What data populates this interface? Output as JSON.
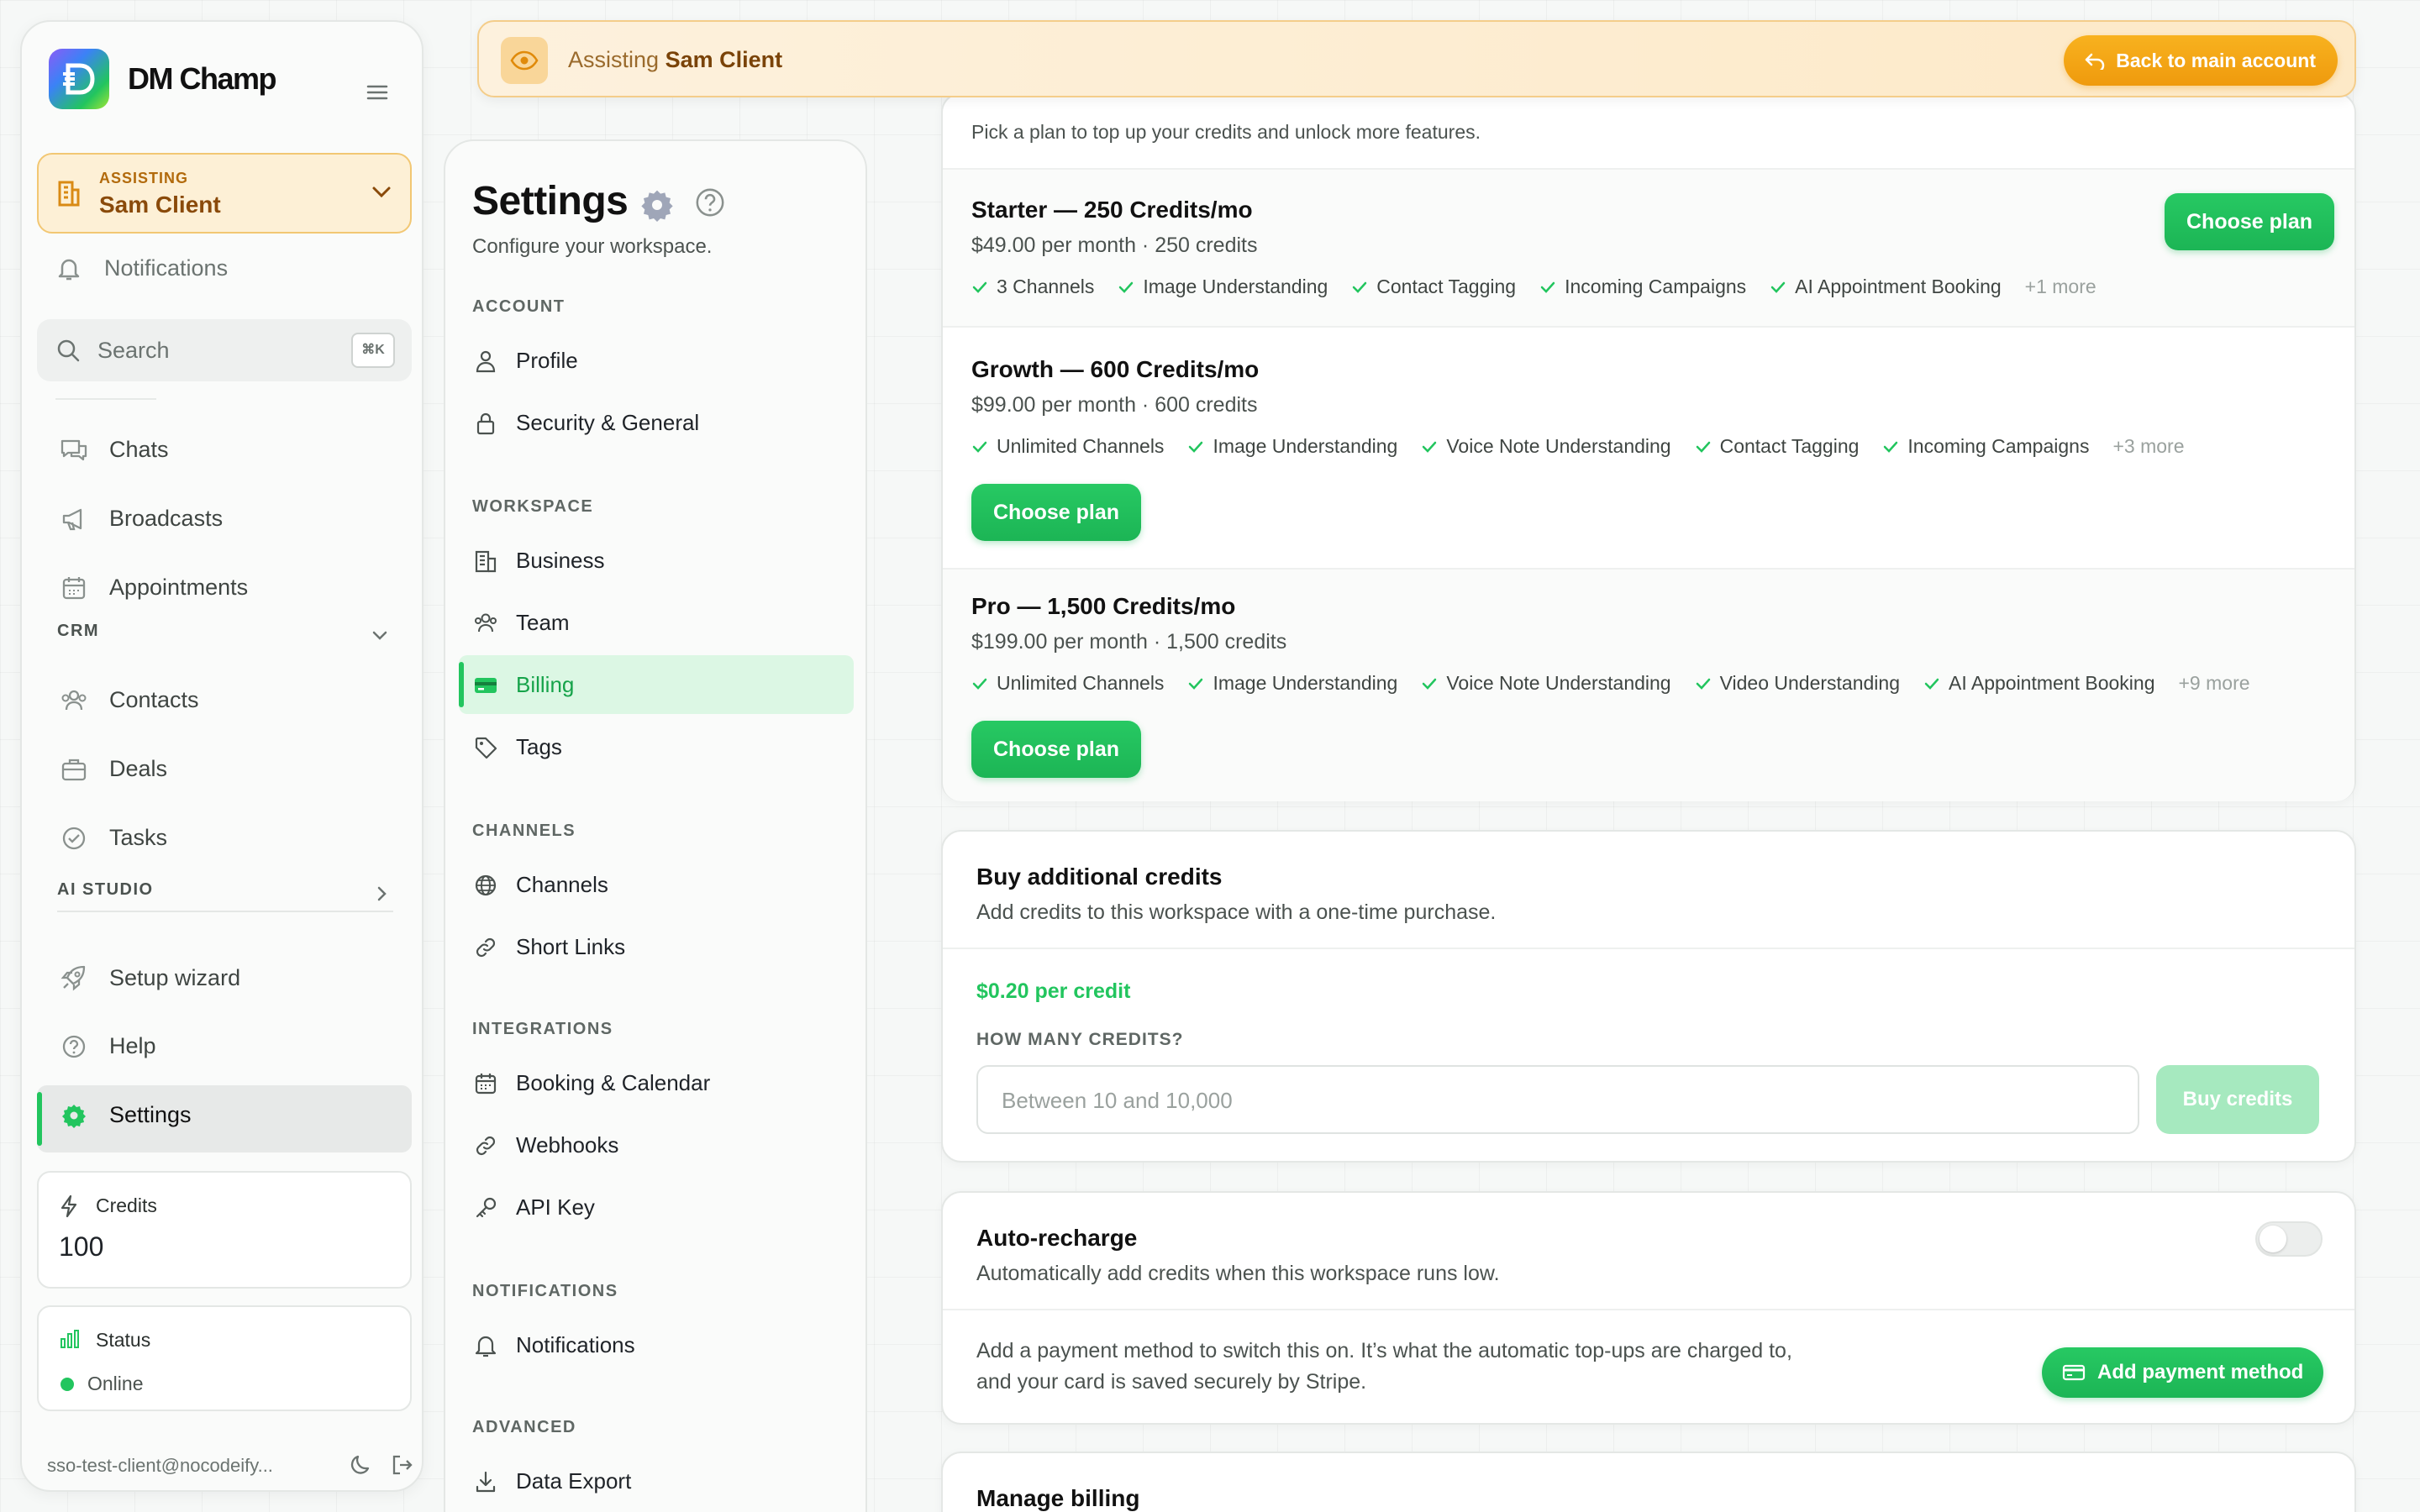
{
  "app": {
    "name": "DM Champ"
  },
  "sidebar": {
    "assisting": {
      "label": "ASSISTING",
      "client": "Sam Client"
    },
    "notifications": "Notifications",
    "search": {
      "placeholder": "Search",
      "shortcut": "⌘K"
    },
    "main_items": [
      {
        "label": "Chats",
        "icon": "chat-icon"
      },
      {
        "label": "Broadcasts",
        "icon": "megaphone-icon"
      },
      {
        "label": "Appointments",
        "icon": "calendar-icon"
      }
    ],
    "crm": {
      "label": "CRM",
      "items": [
        {
          "label": "Contacts",
          "icon": "users-icon"
        },
        {
          "label": "Deals",
          "icon": "briefcase-icon"
        },
        {
          "label": "Tasks",
          "icon": "check-circle-icon"
        }
      ]
    },
    "ai_studio": {
      "label": "AI STUDIO"
    },
    "bottom_items": [
      {
        "label": "Setup wizard",
        "icon": "rocket-icon"
      },
      {
        "label": "Help",
        "icon": "help-icon"
      },
      {
        "label": "Settings",
        "icon": "gear-icon",
        "active": true
      }
    ],
    "credits": {
      "label": "Credits",
      "value": "100"
    },
    "status": {
      "label": "Status",
      "value": "Online"
    },
    "user_email": "sso-test-client@nocodeify..."
  },
  "banner": {
    "prefix": "Assisting",
    "client": "Sam Client",
    "button": "Back to main account"
  },
  "settings_nav": {
    "title": "Settings",
    "subtitle": "Configure your workspace.",
    "groups": [
      {
        "label": "ACCOUNT",
        "items": [
          "Profile",
          "Security & General"
        ]
      },
      {
        "label": "WORKSPACE",
        "items": [
          "Business",
          "Team",
          "Billing",
          "Tags"
        ]
      },
      {
        "label": "CHANNELS",
        "items": [
          "Channels",
          "Short Links"
        ]
      },
      {
        "label": "INTEGRATIONS",
        "items": [
          "Booking & Calendar",
          "Webhooks",
          "API Key"
        ]
      },
      {
        "label": "NOTIFICATIONS",
        "items": [
          "Notifications"
        ]
      },
      {
        "label": "ADVANCED",
        "items": [
          "Data Export"
        ]
      }
    ],
    "active_item": "Billing"
  },
  "plans": {
    "intro": "Pick a plan to top up your credits and unlock more features.",
    "choose_label": "Choose plan",
    "items": [
      {
        "name": "Starter — 250 Credits/mo",
        "price": "$49.00 per month · 250 credits",
        "features": [
          "3 Channels",
          "Image Understanding",
          "Contact Tagging",
          "Incoming Campaigns",
          "AI Appointment Booking"
        ],
        "more": "+1 more"
      },
      {
        "name": "Growth — 600 Credits/mo",
        "price": "$99.00 per month · 600 credits",
        "features": [
          "Unlimited Channels",
          "Image Understanding",
          "Voice Note Understanding",
          "Contact Tagging",
          "Incoming Campaigns"
        ],
        "more": "+3 more"
      },
      {
        "name": "Pro — 1,500 Credits/mo",
        "price": "$199.00 per month · 1,500 credits",
        "features": [
          "Unlimited Channels",
          "Image Understanding",
          "Voice Note Understanding",
          "Video Understanding",
          "AI Appointment Booking"
        ],
        "more": "+9 more"
      }
    ]
  },
  "buy_credits": {
    "title": "Buy additional credits",
    "description": "Add credits to this workspace with a one-time purchase.",
    "price": "$0.20 per credit",
    "field_label": "HOW MANY CREDITS?",
    "placeholder": "Between 10 and 10,000",
    "button": "Buy credits"
  },
  "auto_recharge": {
    "title": "Auto-recharge",
    "description": "Automatically add credits when this workspace runs low.",
    "info": "Add a payment method to switch this on. It’s what the automatic top-ups are charged to, and your card is saved securely by Stripe.",
    "button": "Add payment method",
    "enabled": false
  },
  "manage_billing": {
    "title": "Manage billing"
  },
  "colors": {
    "accent": "#22c55e",
    "warning": "#f5a623",
    "assist_bg": "#fdf0d6"
  }
}
